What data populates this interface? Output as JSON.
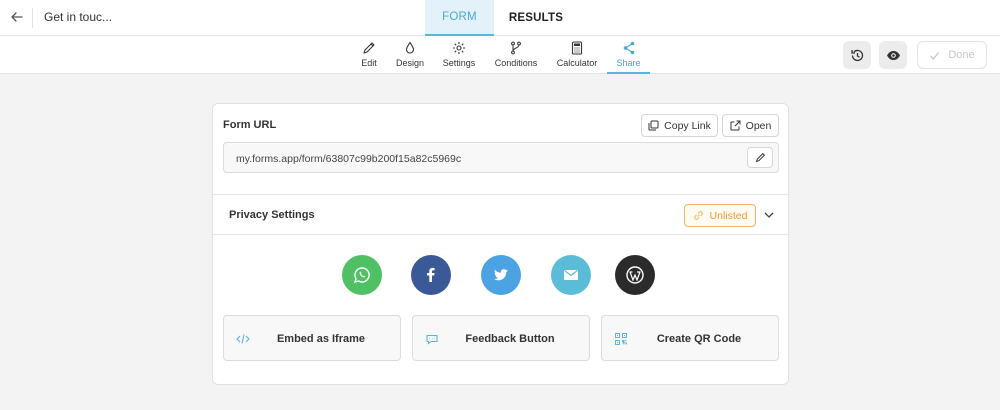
{
  "header": {
    "form_title": "Get in touc...",
    "tabs": [
      {
        "label": "FORM"
      },
      {
        "label": "RESULTS"
      }
    ]
  },
  "toolbar": {
    "items": [
      {
        "label": "Edit",
        "icon": "pencil-icon"
      },
      {
        "label": "Design",
        "icon": "droplet-icon"
      },
      {
        "label": "Settings",
        "icon": "gear-icon"
      },
      {
        "label": "Conditions",
        "icon": "branch-icon"
      },
      {
        "label": "Calculator",
        "icon": "calculator-icon"
      },
      {
        "label": "Share",
        "icon": "share-icon"
      }
    ],
    "active": "Share",
    "done_label": "Done"
  },
  "form_url": {
    "title": "Form URL",
    "copy_label": "Copy Link",
    "open_label": "Open",
    "url": "my.forms.app/form/63807c99b200f15a82c5969c"
  },
  "privacy": {
    "title": "Privacy Settings",
    "status": "Unlisted"
  },
  "social": [
    {
      "name": "whatsapp",
      "color": "#4fc164"
    },
    {
      "name": "facebook",
      "color": "#3b5998"
    },
    {
      "name": "twitter",
      "color": "#4ca3e3"
    },
    {
      "name": "email",
      "color": "#5bbcd8"
    },
    {
      "name": "wordpress",
      "color": "#2b2b2b"
    }
  ],
  "embed": {
    "iframe_label": "Embed as Iframe",
    "feedback_label": "Feedback Button",
    "qr_label": "Create QR Code"
  },
  "colors": {
    "accent": "#5bb6db",
    "unlisted": "#ee9b2c"
  }
}
